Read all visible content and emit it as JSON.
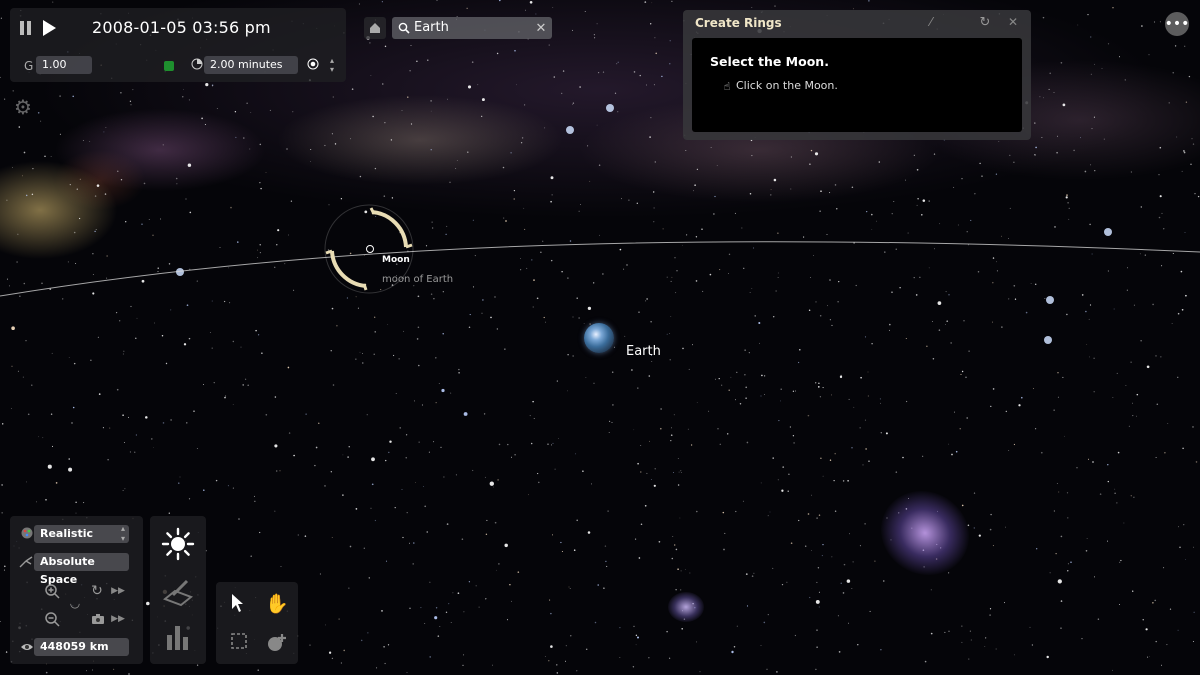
{
  "time_controls": {
    "date_time": "2008-01-05 03:56 pm",
    "gravity_label": "G",
    "gravity_value": "1.00",
    "time_step": "2.00 minutes"
  },
  "search": {
    "value": "Earth"
  },
  "create_rings": {
    "title": "Create Rings",
    "step": "Select the Moon.",
    "hint": "Click on the Moon."
  },
  "scene": {
    "moon_label": "Moon",
    "moon_sublabel": "moon of Earth",
    "earth_label": "Earth"
  },
  "view_controls": {
    "display_mode": "Realistic",
    "reference_frame": "Absolute Space",
    "distance": "448059 km"
  },
  "colors": {
    "status_green": "#1e8f2e",
    "ring_selector": "#e8dcb4",
    "panel_bg": "#1e1e22"
  },
  "icons": [
    "pause-icon",
    "play-icon",
    "home-icon",
    "search-icon",
    "clear-icon",
    "settings-icon",
    "more-icon",
    "sun-icon",
    "edit-icon",
    "chart-icon",
    "pointer-icon",
    "hand-icon",
    "select-box-icon",
    "add-body-icon",
    "eye-icon",
    "zoom-in-icon",
    "zoom-out-icon",
    "camera-icon"
  ]
}
